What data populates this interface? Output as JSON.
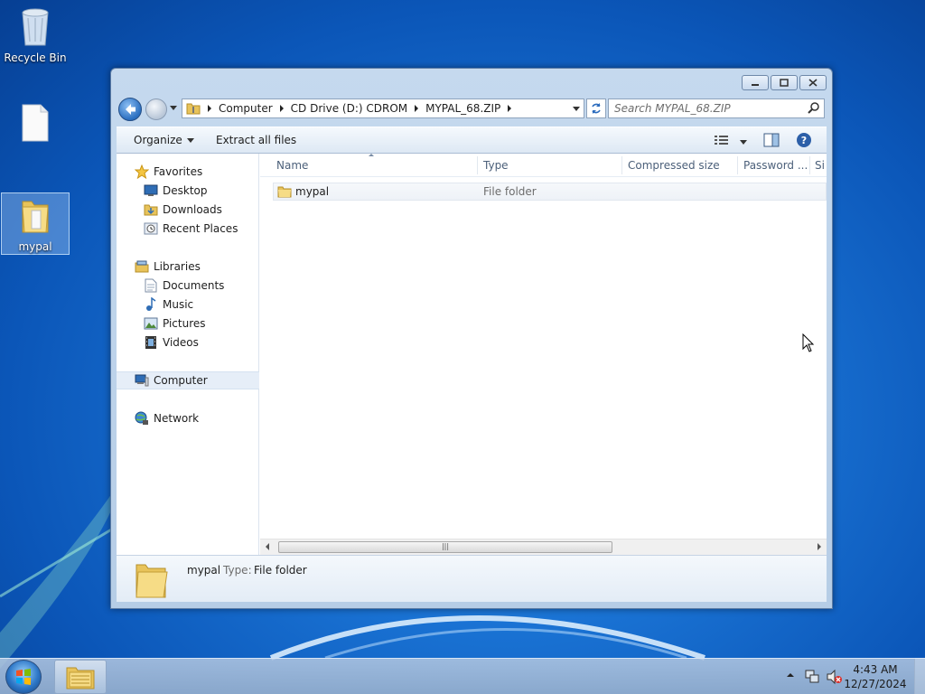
{
  "desktop": {
    "icons": [
      {
        "label": "Recycle Bin",
        "icon": "recycle-bin-icon"
      },
      {
        "label": "",
        "icon": "blank-file-icon"
      },
      {
        "label": "mypal",
        "icon": "folder-icon"
      }
    ]
  },
  "window": {
    "address": {
      "crumbs": [
        "Computer",
        "CD Drive (D:) CDROM",
        "MYPAL_68.ZIP"
      ]
    },
    "search": {
      "placeholder": "Search MYPAL_68.ZIP"
    },
    "toolbar": {
      "organize": "Organize",
      "extract": "Extract all files"
    },
    "nav": {
      "favorites": "Favorites",
      "desktop": "Desktop",
      "downloads": "Downloads",
      "recent": "Recent Places",
      "libraries": "Libraries",
      "documents": "Documents",
      "music": "Music",
      "pictures": "Pictures",
      "videos": "Videos",
      "computer": "Computer",
      "network": "Network"
    },
    "columns": {
      "name": "Name",
      "type": "Type",
      "compressed": "Compressed size",
      "password": "Password ...",
      "size": "Si"
    },
    "files": [
      {
        "name": "mypal",
        "type": "File folder"
      }
    ],
    "details": {
      "name": "mypal",
      "type_label": "Type:",
      "type_value": "File folder"
    }
  },
  "taskbar": {
    "time": "4:43 AM",
    "date": "12/27/2024"
  }
}
